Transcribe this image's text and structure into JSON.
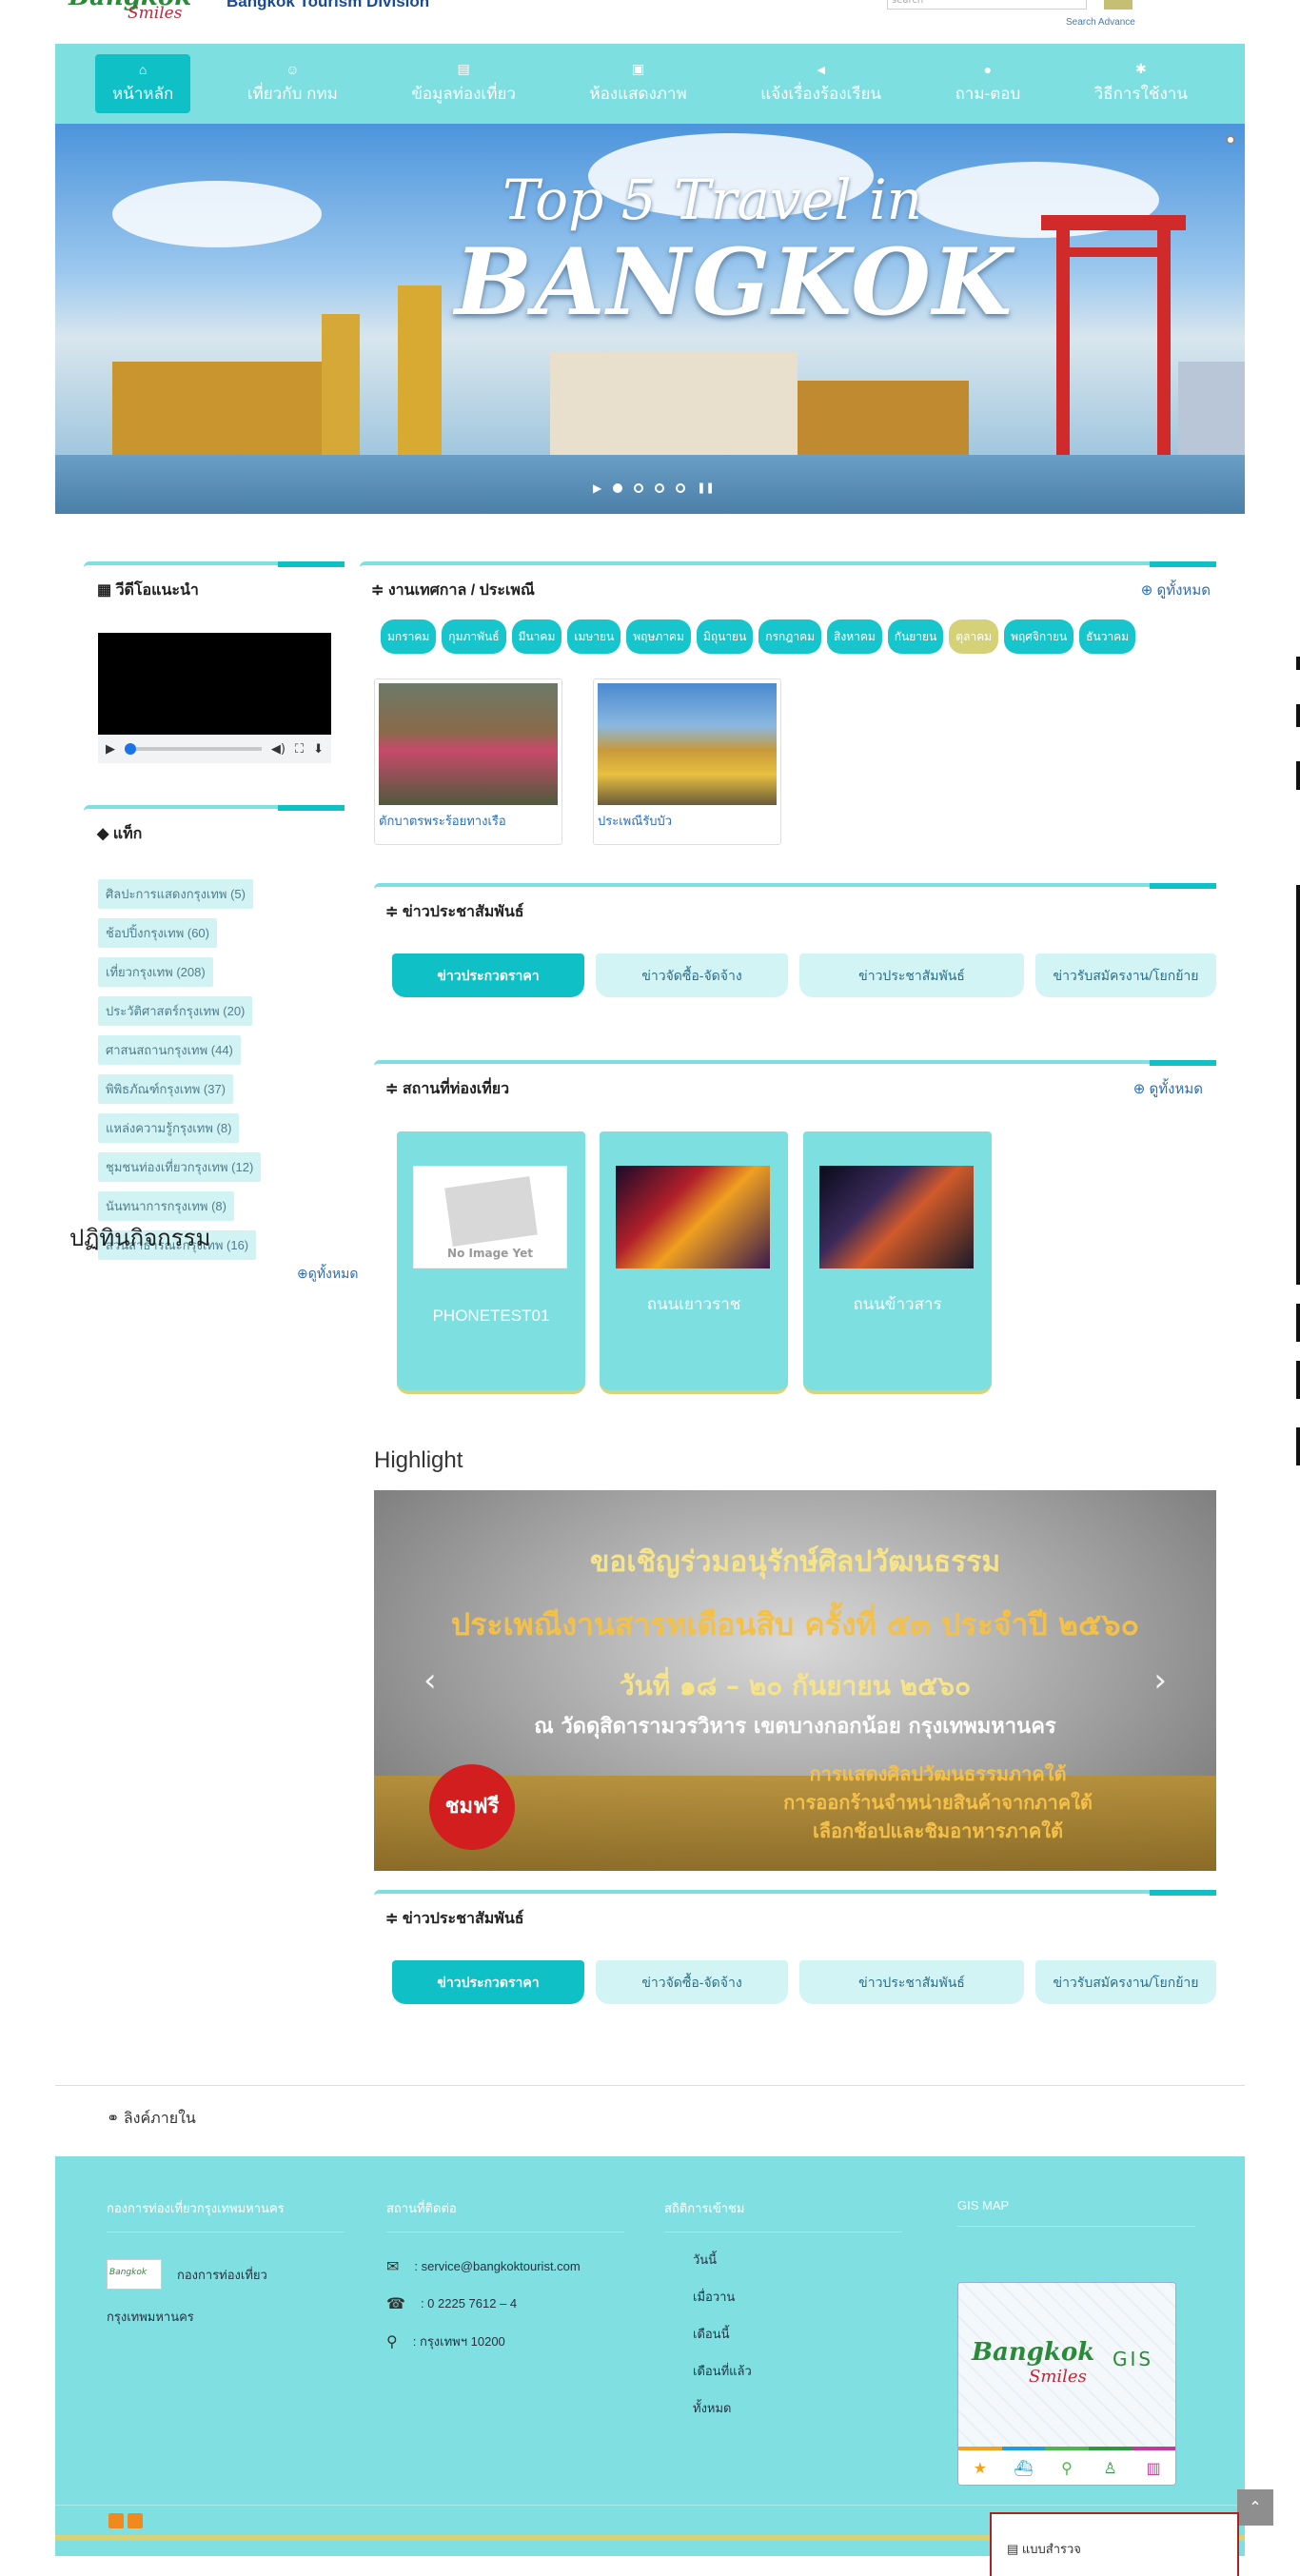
{
  "header": {
    "logo_line1": "Bangkok",
    "logo_line2": "Smiles",
    "site_name": "Bangkok Tourism Division",
    "search_placeholder": "search",
    "search_advance": "Search Advance"
  },
  "nav": [
    {
      "label": "หน้าหลัก",
      "icon": "home-icon",
      "glyph": "⌂"
    },
    {
      "label": "เที่ยวกับ กทม",
      "icon": "users-icon",
      "glyph": "☺"
    },
    {
      "label": "ข้อมูลท่องเที่ยว",
      "icon": "book-icon",
      "glyph": "▤"
    },
    {
      "label": "ห้องแสดงภาพ",
      "icon": "image-icon",
      "glyph": "▣"
    },
    {
      "label": "แจ้งเรื่องร้องเรียน",
      "icon": "bullhorn-icon",
      "glyph": "◄"
    },
    {
      "label": "ถาม-ตอบ",
      "icon": "comments-icon",
      "glyph": "●"
    },
    {
      "label": "วิธีการใช้งาน",
      "icon": "gears-icon",
      "glyph": "✱"
    }
  ],
  "banner": {
    "line1": "Top 5 Travel in",
    "line2": "BANGKOK"
  },
  "video": {
    "title": "วีดีโอแนะนำ"
  },
  "tags": {
    "title": "แท็ก",
    "items": [
      "ศิลปะการแสดงกรุงเทพ (5)",
      "ช้อปปิ้งกรุงเทพ (60)",
      "เที่ยวกรุงเทพ (208)",
      "ประวัติศาสตร์กรุงเทพ (20)",
      "ศาสนสถานกรุงเทพ (44)",
      "พิพิธภัณฑ์กรุงเทพ (37)",
      "แหล่งความรู้กรุงเทพ (8)",
      "ชุมชนท่องเที่ยวกรุงเทพ (12)",
      "นันทนาการกรุงเทพ (8)",
      "สวนสาธารณะกรุงเทพ (16)"
    ]
  },
  "activities": {
    "title": "ปฏิทินกิจกรรม",
    "view_all": "ดูทั้งหมด"
  },
  "festivals": {
    "title": "งานเทศกาล / ประเพณี",
    "view_all": "ดูทั้งหมด",
    "months": [
      "มกราคม",
      "กุมภาพันธ์",
      "มีนาคม",
      "เมษายน",
      "พฤษภาคม",
      "มิถุนายน",
      "กรกฎาคม",
      "สิงหาคม",
      "กันยายน",
      "ตุลาคม",
      "พฤศจิกายน",
      "ธันวาคม"
    ],
    "selected_month": "ตุลาคม",
    "cards": [
      {
        "caption": "ตักบาตรพระร้อยทางเรือ"
      },
      {
        "caption": "ประเพณีรับบัว"
      }
    ]
  },
  "news1": {
    "title": "ข่าวประชาสัมพันธ์",
    "tabs": [
      "ข่าวประกวดราคา",
      "ข่าวจัดซื้อ-จัดจ้าง",
      "ข่าวประชาสัมพันธ์",
      "ข่าวรับสมัครงาน/โยกย้าย"
    ]
  },
  "attractions": {
    "title": "สถานที่ท่องเที่ยว",
    "view_all": "ดูทั้งหมด",
    "no_image": "No Image Yet",
    "cards": [
      {
        "name": "PHONETEST01"
      },
      {
        "name": "ถนนเยาวราช"
      },
      {
        "name": "ถนนข้าวสาร"
      }
    ]
  },
  "highlight": {
    "title": "Highlight",
    "line1": "ขอเชิญร่วมอนุรักษ์ศิลปวัฒนธรรม",
    "line2": "ประเพณีงานสารทเดือนสิบ ครั้งที่ ๕๓ ประจำปี ๒๕๖๐",
    "line3": "วันที่ ๑๘ – ๒๐ กันยายน ๒๕๖๐",
    "line4": "ณ วัดดุสิดารามวรวิหาร เขตบางกอกน้อย กรุงเทพมหานคร",
    "line5": "การแสดงศิลปวัฒนธรรมภาคใต้",
    "line6": "การออกร้านจำหน่ายสินค้าจากภาคใต้",
    "line7": "เลือกช้อปและชิมอาหารภาคใต้",
    "free": "ชมฟรี"
  },
  "news2": {
    "title": "ข่าวประชาสัมพันธ์",
    "tabs": [
      "ข่าวประกวดราคา",
      "ข่าวจัดซื้อ-จัดจ้าง",
      "ข่าวประชาสัมพันธ์",
      "ข่าวรับสมัครงาน/โยกย้าย"
    ]
  },
  "internal_links": {
    "title": "ลิงค์ภายใน"
  },
  "footer": {
    "col1_title": "กองการท่องเที่ยวกรุงเทพมหานคร",
    "org_line1": "กองการท่องเที่ยว",
    "org_line2": "กรุงเทพมหานคร",
    "col2_title": "สถานที่ติดต่อ",
    "email": ": service@bangkoktourist.com",
    "phone": ": 0 2225 7612 – 4",
    "address": ": กรุงเทพฯ 10200",
    "col3_title": "สถิติการเข้าชม",
    "stats": [
      "วันนี้",
      "เมื่อวาน",
      "เดือนนี้",
      "เดือนที่แล้ว",
      "ทั้งหมด"
    ],
    "col4_title": "GIS MAP",
    "gis_logo1": "Bangkok",
    "gis_logo2": "Smiles",
    "gis_text": "GIS"
  },
  "survey": {
    "label": "แบบสำรวจ"
  }
}
